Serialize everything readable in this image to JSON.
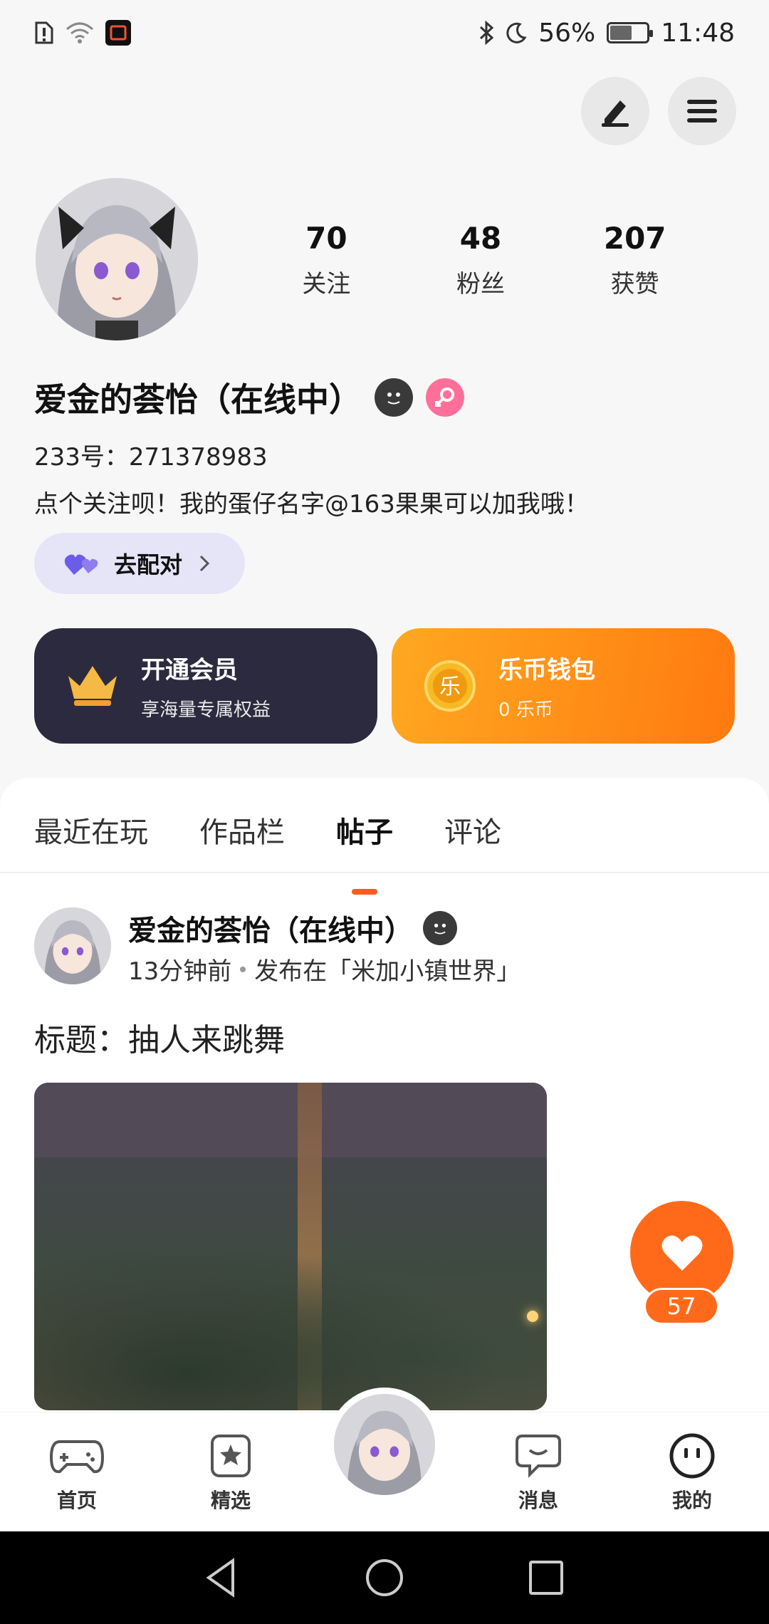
{
  "status_bar": {
    "battery": "56%",
    "time": "11:48"
  },
  "profile": {
    "stats": [
      {
        "num": "70",
        "label": "关注"
      },
      {
        "num": "48",
        "label": "粉丝"
      },
      {
        "num": "207",
        "label": "获赞"
      }
    ],
    "name": "爱金的荟怡（在线中）",
    "uid": "233号：271378983",
    "bio": "点个关注呗！我的蛋仔名字@163果果可以加我哦！",
    "match_button": "去配对"
  },
  "cards": {
    "vip": {
      "title": "开通会员",
      "sub": "享海量专属权益"
    },
    "wallet": {
      "title": "乐币钱包",
      "sub": "0 乐币"
    }
  },
  "tabs": [
    {
      "label": "最近在玩"
    },
    {
      "label": "作品栏"
    },
    {
      "label": "帖子"
    },
    {
      "label": "评论"
    }
  ],
  "post": {
    "author": "爱金的荟怡（在线中）",
    "time": "13分钟前",
    "published_in": "发布在「米加小镇世界」",
    "title": "标题：抽人来跳舞",
    "likes": "57"
  },
  "bottom_nav": [
    {
      "label": "首页"
    },
    {
      "label": "精选"
    },
    {
      "label": "消息"
    },
    {
      "label": "我的"
    }
  ],
  "colors": {
    "accent": "#ff6a1a",
    "vip_card": "#2c2a3e",
    "match_bg": "#e6e4f7"
  }
}
